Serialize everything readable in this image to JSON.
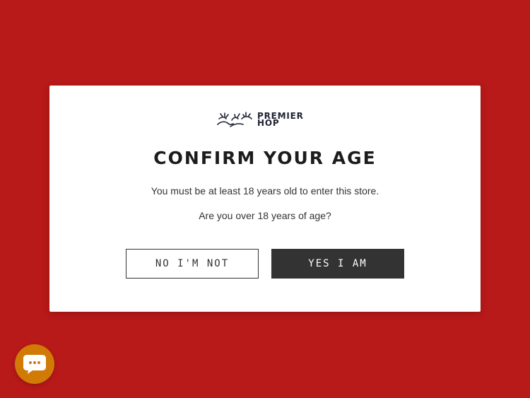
{
  "colors": {
    "background": "#b81919",
    "modal": "#ffffff",
    "primary_button": "#333333",
    "chat_button": "#d17a06"
  },
  "logo": {
    "line1": "PREMIER",
    "line2": "HOP",
    "icon": "hop-leaves-logo-icon"
  },
  "modal": {
    "title": "CONFIRM YOUR AGE",
    "message": "You must be at least 18 years old to enter this store.",
    "question": "Are you over 18 years of age?",
    "deny_label": "NO I'M NOT",
    "confirm_label": "YES I AM"
  },
  "chat": {
    "icon": "chat-bubble-icon"
  }
}
